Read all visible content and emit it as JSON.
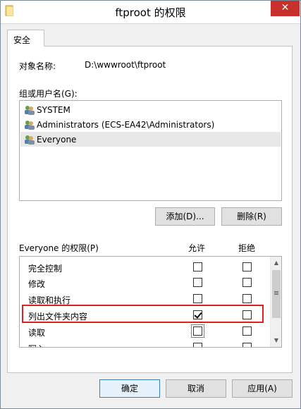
{
  "window": {
    "title": "ftproot 的权限",
    "close_glyph": "✕"
  },
  "tabs": [
    {
      "label": "安全"
    }
  ],
  "object": {
    "label": "对象名称:",
    "value": "D:\\wwwroot\\ftproot"
  },
  "groups": {
    "label": "组或用户名(G):",
    "items": [
      {
        "label": "SYSTEM",
        "icon": "user-group-icon",
        "selected": false
      },
      {
        "label": "Administrators (ECS-EA42\\Administrators)",
        "icon": "user-group-icon",
        "selected": false
      },
      {
        "label": "Everyone",
        "icon": "user-group-icon",
        "selected": true
      }
    ],
    "add_button": "添加(D)...",
    "remove_button": "删除(R)"
  },
  "permissions": {
    "label": "Everyone 的权限(P)",
    "allow_header": "允许",
    "deny_header": "拒绝",
    "rows": [
      {
        "name": "完全控制",
        "allow": false,
        "deny": false
      },
      {
        "name": "修改",
        "allow": false,
        "deny": false
      },
      {
        "name": "读取和执行",
        "allow": false,
        "deny": false
      },
      {
        "name": "列出文件夹内容",
        "allow": true,
        "deny": false,
        "highlighted": true
      },
      {
        "name": "读取",
        "allow": false,
        "deny": false,
        "focused": true
      },
      {
        "name": "写入",
        "allow": false,
        "deny": false
      }
    ]
  },
  "footer": {
    "ok": "确定",
    "cancel": "取消",
    "apply": "应用(A)"
  },
  "colors": {
    "highlight_box": "#e02020",
    "close_button": "#c7302b"
  }
}
